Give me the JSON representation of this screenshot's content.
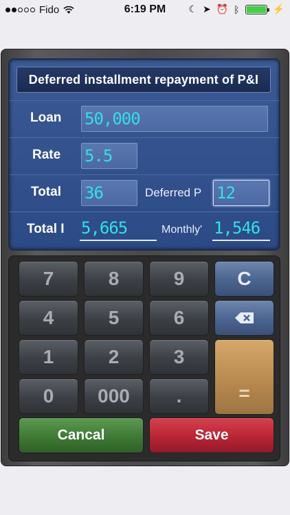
{
  "status": {
    "carrier": "Fido",
    "time": "6:19 PM"
  },
  "screen": {
    "title": "Deferred installment repayment of P&I",
    "loan_label": "Loan",
    "loan_value": "50,000",
    "rate_label": "Rate",
    "rate_value": "5.5",
    "total_label": "Total",
    "total_value": "36",
    "deferred_label": "Deferred P",
    "deferred_value": "12",
    "total_interest_label": "Total I",
    "total_interest_value": "5,665",
    "monthly_label": "Monthly'",
    "monthly_value": "1,546"
  },
  "keypad": {
    "k7": "7",
    "k8": "8",
    "k9": "9",
    "clear": "C",
    "k4": "4",
    "k5": "5",
    "k6": "6",
    "k1": "1",
    "k2": "2",
    "k3": "3",
    "equals": "=",
    "k0": "0",
    "k000": "000",
    "dot": ".",
    "cancel": "Cancal",
    "save": "Save"
  },
  "colors": {
    "screen_bg": "#2c4a85",
    "digit_color": "#2fe2e8",
    "cancel_green": "#3f7a35",
    "save_red": "#b82533",
    "equals_gold": "#b98a50"
  }
}
